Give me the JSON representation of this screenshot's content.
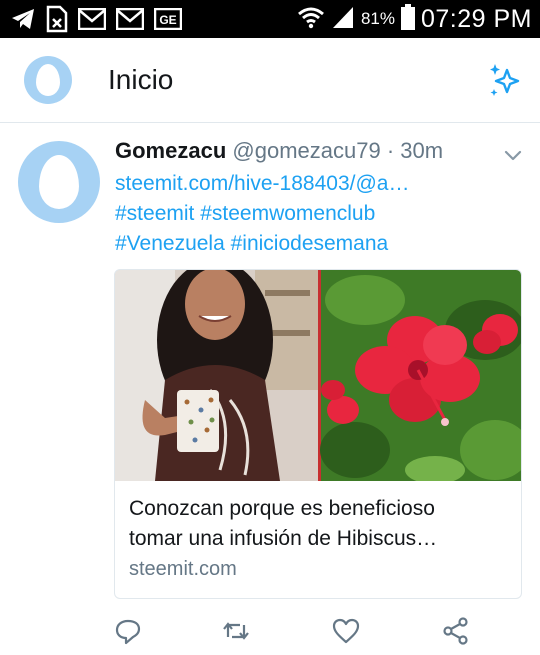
{
  "status_bar": {
    "battery": "81%",
    "time": "07:29 PM",
    "icons": [
      "telegram-icon",
      "sim-icon",
      "gmail-icon",
      "gmail-icon",
      "ge-icon",
      "wifi-icon",
      "signal-icon",
      "battery-icon"
    ]
  },
  "app_bar": {
    "title": "Inicio",
    "profile_icon": "default-egg-avatar",
    "action_icon": "sparkle-icon"
  },
  "tweet": {
    "name": "Gomezacu",
    "handle": "@gomezacu79",
    "separator": "·",
    "time": "30m",
    "lines": [
      "steemit.com/hive-188403/@a…",
      "#steemit #steemwomenclub",
      "#Venezuela #iniciodesemana"
    ],
    "card": {
      "title_lines": [
        "Conozcan porque es beneficioso",
        "tomar una infusión de Hibiscus…"
      ],
      "domain": "steemit.com"
    },
    "actions": [
      "reply-icon",
      "retweet-icon",
      "like-icon",
      "share-icon"
    ]
  },
  "colors": {
    "accent": "#1da1f2",
    "avatar_bg": "#a7d2f4",
    "muted": "#657786",
    "hibiscus_red": "#e8263f",
    "leaf_green": "#3e7a26"
  }
}
